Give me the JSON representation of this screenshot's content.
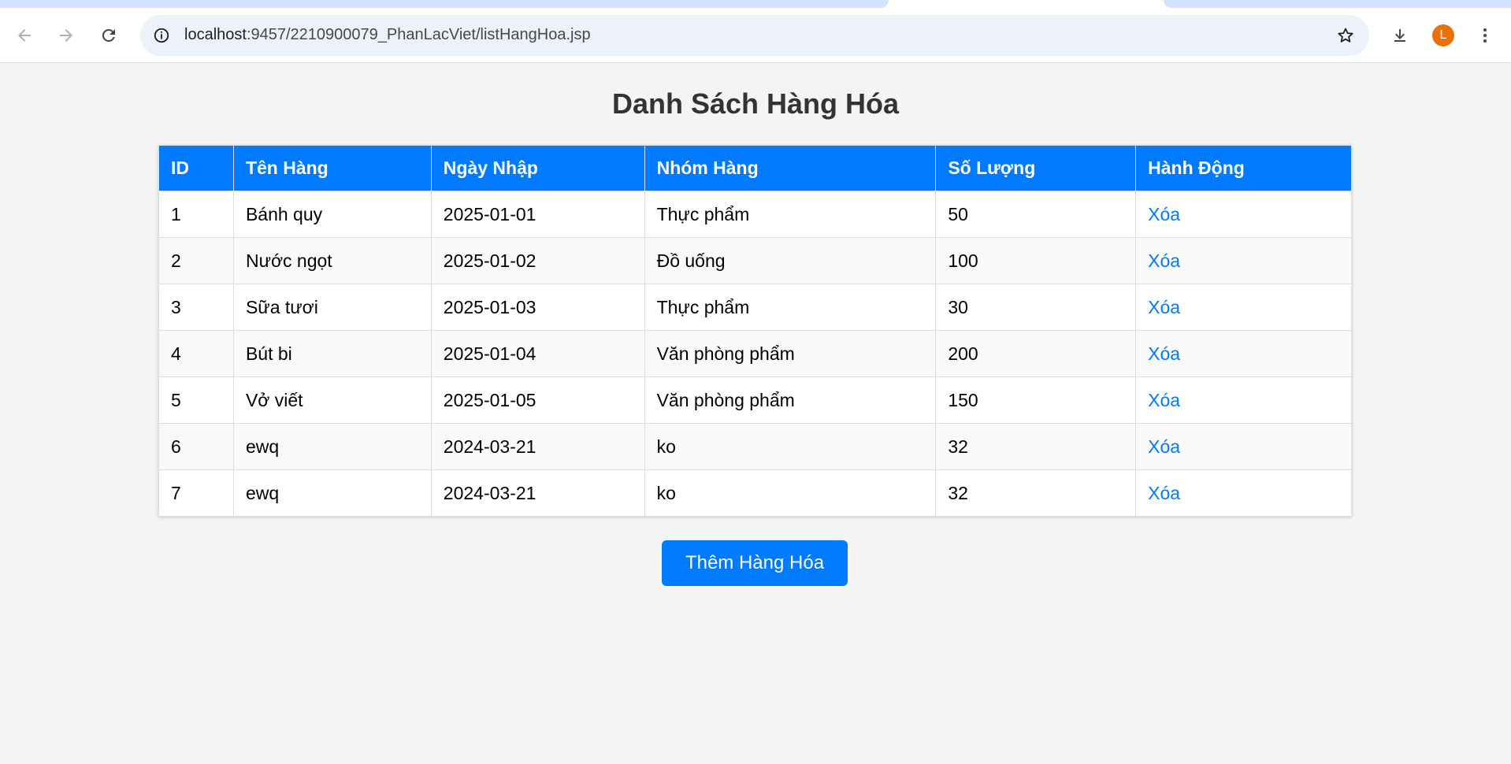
{
  "browser": {
    "url_host": "localhost",
    "url_rest": ":9457/2210900079_PhanLacViet/listHangHoa.jsp",
    "profile_initial": "L"
  },
  "page": {
    "title": "Danh Sách Hàng Hóa",
    "table": {
      "headers": [
        "ID",
        "Tên Hàng",
        "Ngày Nhập",
        "Nhóm Hàng",
        "Số Lượng",
        "Hành Động"
      ],
      "rows": [
        {
          "id": "1",
          "name": "Bánh quy",
          "date": "2025-01-01",
          "group": "Thực phẩm",
          "qty": "50",
          "action": "Xóa"
        },
        {
          "id": "2",
          "name": "Nước ngọt",
          "date": "2025-01-02",
          "group": "Đồ uống",
          "qty": "100",
          "action": "Xóa"
        },
        {
          "id": "3",
          "name": "Sữa tươi",
          "date": "2025-01-03",
          "group": "Thực phẩm",
          "qty": "30",
          "action": "Xóa"
        },
        {
          "id": "4",
          "name": "Bút bi",
          "date": "2025-01-04",
          "group": "Văn phòng phẩm",
          "qty": "200",
          "action": "Xóa"
        },
        {
          "id": "5",
          "name": "Vở viết",
          "date": "2025-01-05",
          "group": "Văn phòng phẩm",
          "qty": "150",
          "action": "Xóa"
        },
        {
          "id": "6",
          "name": "ewq",
          "date": "2024-03-21",
          "group": "ko",
          "qty": "32",
          "action": "Xóa"
        },
        {
          "id": "7",
          "name": "ewq",
          "date": "2024-03-21",
          "group": "ko",
          "qty": "32",
          "action": "Xóa"
        }
      ]
    },
    "add_button": "Thêm Hàng Hóa"
  },
  "colors": {
    "accent": "#007bff",
    "background": "#f4f4f4",
    "avatar": "#e8710a"
  },
  "icons": {
    "back": "arrow-left-icon",
    "forward": "arrow-right-icon",
    "reload": "reload-icon",
    "info": "info-icon",
    "bookmark": "star-icon",
    "download": "download-icon",
    "menu": "kebab-menu-icon"
  }
}
